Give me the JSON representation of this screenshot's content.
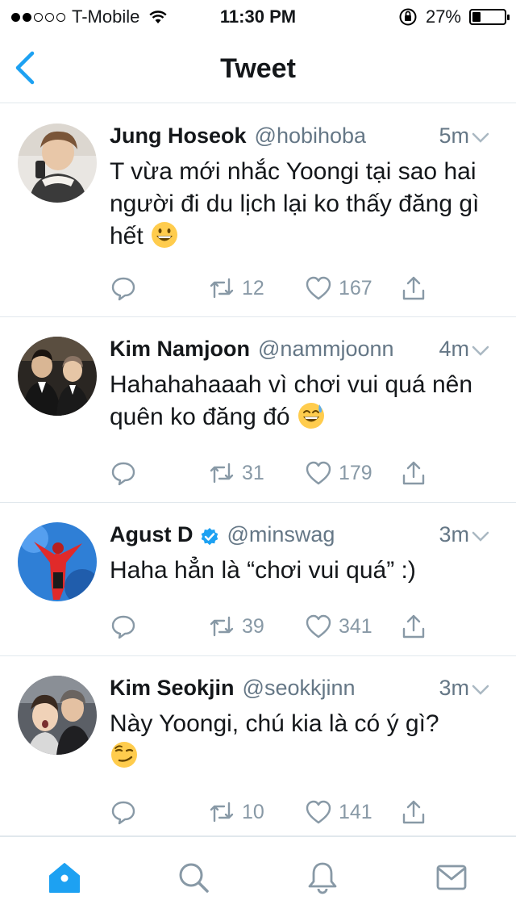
{
  "status_bar": {
    "carrier": "T-Mobile",
    "time": "11:30 PM",
    "battery_percent": "27%",
    "battery_level": 0.27,
    "signal_bars_filled": 2,
    "signal_bars_total": 5
  },
  "nav": {
    "title": "Tweet",
    "back_icon": "chevron-left-icon"
  },
  "colors": {
    "accent": "#1da1f2",
    "secondary_text": "#657786",
    "action_gray": "#8899a6",
    "divider": "#e1e8ed"
  },
  "tweets": [
    {
      "name": "Jung Hoseok",
      "handle": "@hobihoba",
      "verified": false,
      "time": "5m",
      "text": "T vừa mới nhắc Yoongi tại sao hai người đi du lịch lại ko thấy đăng gì hết",
      "emoji": "grinning-face",
      "retweets": "12",
      "likes": "167"
    },
    {
      "name": "Kim Namjoon",
      "handle": "@nammjoonn",
      "verified": false,
      "time": "4m",
      "text": "Hahahahaaah vì chơi vui quá nên quên ko đăng đó",
      "emoji": "grinning-face-with-sweat",
      "retweets": "31",
      "likes": "179"
    },
    {
      "name": "Agust D",
      "handle": "@minswag",
      "verified": true,
      "time": "3m",
      "text": "Haha hẳn là “chơi vui quá” :)",
      "emoji": "",
      "retweets": "39",
      "likes": "341"
    },
    {
      "name": "Kim Seokjin",
      "handle": "@seokkjinn",
      "verified": false,
      "time": "3m",
      "text": "Này Yoongi, chú kia là có ý gì?",
      "emoji": "smirking-face",
      "retweets": "10",
      "likes": "141"
    }
  ],
  "tab_bar": {
    "tabs": [
      "home-icon",
      "search-icon",
      "notifications-icon",
      "messages-icon"
    ],
    "active": "home-icon"
  }
}
